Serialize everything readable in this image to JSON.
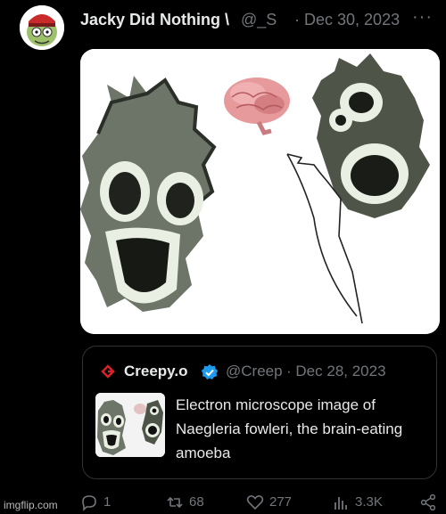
{
  "post": {
    "author_name": "Jacky Did Nothing \\",
    "handle": "@_S",
    "separator": "·",
    "date": "Dec 30, 2023",
    "more": "···"
  },
  "quoted": {
    "name": "Creepy.o",
    "handle": "@Creep",
    "separator": "·",
    "date": "Dec 28, 2023",
    "text": "Electron microscope image of Naegleria fowleri, the brain-eating amoeba",
    "brand_color": "#d8222a",
    "verified_color": "#1d9bf0"
  },
  "actions": {
    "reply_count": "1",
    "repost_count": "68",
    "like_count": "277",
    "view_count": "3.3K"
  },
  "watermark": "imgflip.com",
  "colors": {
    "background": "#000000",
    "text": "#e7e9ea",
    "muted": "#71767b",
    "border": "#2f3336"
  }
}
